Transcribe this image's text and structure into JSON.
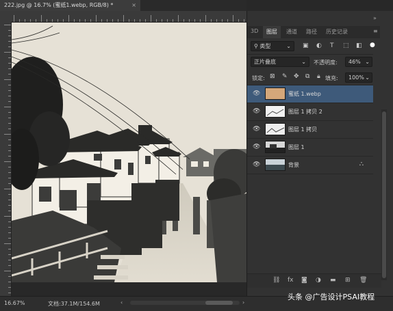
{
  "document": {
    "tab_title": "222.jpg @ 16.7% (蜜纸1.webp, RGB/8) *",
    "close": "×"
  },
  "panel": {
    "tabs": [
      "3D",
      "图层",
      "通道",
      "路径",
      "历史记录"
    ],
    "menu_icon": "menu-icon",
    "collapse_icon": "double-chevron-icon",
    "filter": {
      "kind_label": "类型",
      "icons": [
        "image-filter-icon",
        "adjustment-filter-icon",
        "type-filter-icon",
        "shape-filter-icon",
        "smart-object-filter-icon"
      ]
    },
    "blend_mode": "正片叠底",
    "opacity_label": "不透明度:",
    "opacity_value": "46%",
    "lock_label": "锁定:",
    "fill_label": "填充:",
    "fill_value": "100%",
    "layers": [
      {
        "name": "蜜纸 1.webp",
        "selected": true,
        "locked": false
      },
      {
        "name": "图层 1 拷贝 2",
        "selected": false,
        "locked": false
      },
      {
        "name": "图层 1 拷贝",
        "selected": false,
        "locked": false
      },
      {
        "name": "图层 1",
        "selected": false,
        "locked": false
      },
      {
        "name": "背景",
        "selected": false,
        "locked": true
      }
    ],
    "footer_icons": [
      "link-icon",
      "fx-icon",
      "mask-icon",
      "adjustment-icon",
      "folder-icon",
      "new-layer-icon",
      "trash-icon"
    ]
  },
  "status": {
    "zoom": "16.67%",
    "doc_size": "文档:37.1M/154.6M"
  },
  "watermark": "头条 @广告设计PSAI教程",
  "colors": {
    "selected_layer": "#3e5a7a",
    "panel_bg": "#323232",
    "paper_tone": "#e6e1d6",
    "thumb_paper": "#d4a77a"
  }
}
